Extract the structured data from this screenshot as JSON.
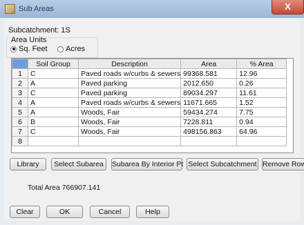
{
  "window": {
    "title": "Sub Areas",
    "close_label": "X"
  },
  "subcatchment": {
    "label": "Subcatchment: 1S"
  },
  "area_units": {
    "legend": "Area Units",
    "options": [
      {
        "label": "Sq. Feet",
        "selected": true
      },
      {
        "label": "Acres",
        "selected": false
      }
    ]
  },
  "table": {
    "columns": [
      "Soil Group",
      "Description",
      "Area",
      "% Area"
    ],
    "rows": [
      {
        "num": "1",
        "soil": "C",
        "desc": "Paved roads w/curbs & sewers",
        "area": "99368.581",
        "pct": "12.96"
      },
      {
        "num": "2",
        "soil": "A",
        "desc": "Paved parking",
        "area": "2012.650",
        "pct": "0.26"
      },
      {
        "num": "3",
        "soil": "C",
        "desc": "Paved parking",
        "area": "89034.297",
        "pct": "11.61"
      },
      {
        "num": "4",
        "soil": "A",
        "desc": "Paved roads w/curbs & sewers",
        "area": "11671.665",
        "pct": "1.52"
      },
      {
        "num": "5",
        "soil": "A",
        "desc": "Woods, Fair",
        "area": "59434.274",
        "pct": "7.75"
      },
      {
        "num": "6",
        "soil": "B",
        "desc": "Woods, Fair",
        "area": "7228.811",
        "pct": "0.94"
      },
      {
        "num": "7",
        "soil": "C",
        "desc": "Woods, Fair",
        "area": "498156.863",
        "pct": "64.96"
      },
      {
        "num": "8",
        "soil": "",
        "desc": "",
        "area": "",
        "pct": ""
      }
    ]
  },
  "actions": {
    "library": "Library",
    "select_subarea": "Select Subarea",
    "subarea_by_interior_pt": "Subarea By Interior Pt",
    "select_subcatchment": "Select Subcatchment",
    "remove_row": "Remove Row"
  },
  "total_area": {
    "label": "Total Area",
    "value": "766907.141"
  },
  "footer": {
    "clear": "Clear",
    "ok": "OK",
    "cancel": "Cancel",
    "help": "Help"
  }
}
